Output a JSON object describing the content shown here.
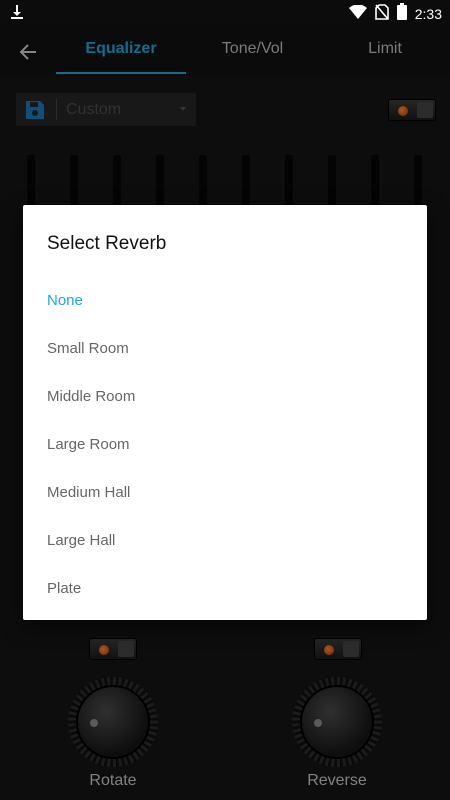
{
  "status_bar": {
    "time": "2:33",
    "icons": [
      "download-icon",
      "wifi-icon",
      "no-sim-icon",
      "battery-icon"
    ]
  },
  "tabs": [
    {
      "label": "Equalizer",
      "active": true
    },
    {
      "label": "Tone/Vol",
      "active": false
    },
    {
      "label": "Limit",
      "active": false
    }
  ],
  "preset": {
    "name": "Custom",
    "icon": "save-icon"
  },
  "dialog": {
    "title": "Select Reverb",
    "options": [
      {
        "label": "None",
        "selected": true
      },
      {
        "label": "Small Room",
        "selected": false
      },
      {
        "label": "Middle Room",
        "selected": false
      },
      {
        "label": "Large Room",
        "selected": false
      },
      {
        "label": "Medium Hall",
        "selected": false
      },
      {
        "label": "Large Hall",
        "selected": false
      },
      {
        "label": "Plate",
        "selected": false
      }
    ]
  },
  "knobs": [
    {
      "label": "Rotate"
    },
    {
      "label": "Reverse"
    }
  ],
  "colors": {
    "accent": "#1fa8d8",
    "background": "#141414",
    "led": "#ff6a1a"
  }
}
